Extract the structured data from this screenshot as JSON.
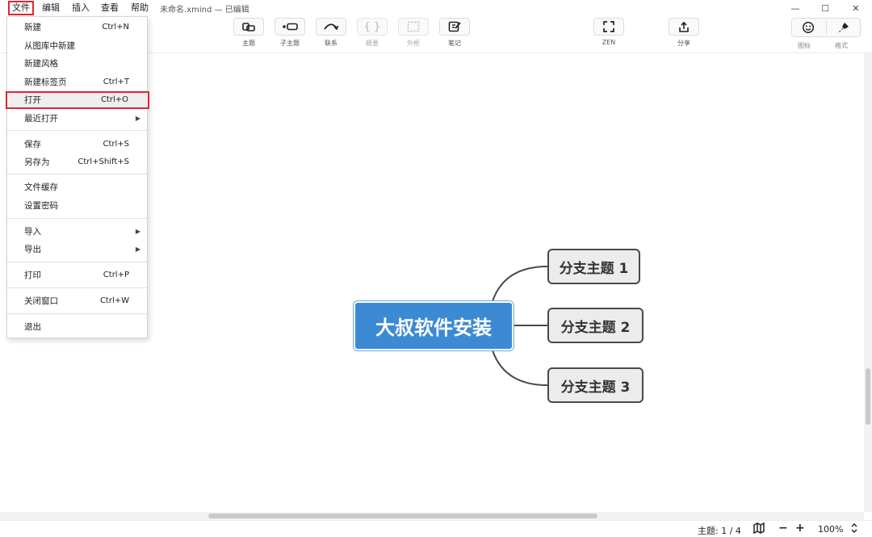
{
  "menubar": {
    "items": [
      "文件",
      "编辑",
      "插入",
      "查看",
      "帮助"
    ],
    "doc_title": "未命名.xmind — 已编辑"
  },
  "window_controls": {
    "minimize": "—",
    "maximize": "☐",
    "close": "✕"
  },
  "toolbar": {
    "topic": "主题",
    "subtopic": "子主题",
    "relationship": "联系",
    "summary": "概要",
    "boundary": "外框",
    "note": "笔记",
    "zen": "ZEN",
    "share": "分享",
    "icon_panel": "图标",
    "format_panel": "格式"
  },
  "file_menu": {
    "items": [
      {
        "label": "新建",
        "shortcut": "Ctrl+N"
      },
      {
        "label": "从图库中新建",
        "shortcut": ""
      },
      {
        "label": "新建风格",
        "shortcut": ""
      },
      {
        "label": "新建标签页",
        "shortcut": "Ctrl+T"
      },
      {
        "label": "打开",
        "shortcut": "Ctrl+O"
      },
      {
        "label": "最近打开",
        "shortcut": ""
      },
      {
        "label": "保存",
        "shortcut": "Ctrl+S"
      },
      {
        "label": "另存为",
        "shortcut": "Ctrl+Shift+S"
      },
      {
        "label": "文件缓存",
        "shortcut": ""
      },
      {
        "label": "设置密码",
        "shortcut": ""
      },
      {
        "label": "导入",
        "shortcut": ""
      },
      {
        "label": "导出",
        "shortcut": ""
      },
      {
        "label": "打印",
        "shortcut": "Ctrl+P"
      },
      {
        "label": "关闭窗口",
        "shortcut": "Ctrl+W"
      },
      {
        "label": "退出",
        "shortcut": ""
      }
    ]
  },
  "mindmap": {
    "central_topic": "大叔软件安装",
    "branches": [
      "分支主题 1",
      "分支主题 2",
      "分支主题 3"
    ]
  },
  "status": {
    "topic_count": "主题: 1 / 4",
    "zoom": "100%",
    "zoom_out": "−",
    "zoom_in": "+"
  },
  "colors": {
    "central": "#3d8ad4",
    "branch_fill": "#ececec",
    "highlight": "#e0262e"
  }
}
